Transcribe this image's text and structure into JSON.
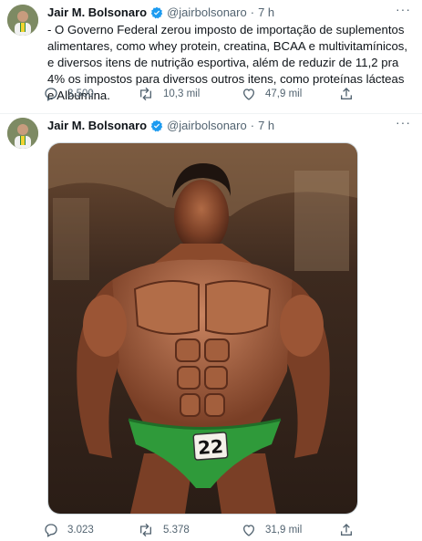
{
  "tweets": [
    {
      "author_name": "Jair M. Bolsonaro",
      "handle": "@jairbolsonaro",
      "time": "7 h",
      "text": "- O Governo Federal zerou imposto de importação de suplementos alimentares, como whey protein, creatina, BCAA e multivitamínicos, e diversos itens de nutrição esportiva, além de reduzir de 11,2 pra 4% os impostos para diversos outros itens, como proteínas lácteas e Albumina.",
      "replies": "3.500",
      "retweets": "10,3 mil",
      "likes": "47,9 mil"
    },
    {
      "author_name": "Jair M. Bolsonaro",
      "handle": "@jairbolsonaro",
      "time": "7 h",
      "image_number": "22",
      "replies": "3.023",
      "retweets": "5.378",
      "likes": "31,9 mil"
    }
  ],
  "separator": "·",
  "more_glyph": "···",
  "colors": {
    "verified": "#1d9bf0",
    "muted": "#536471",
    "swimsuit": "#2f9a3a"
  }
}
